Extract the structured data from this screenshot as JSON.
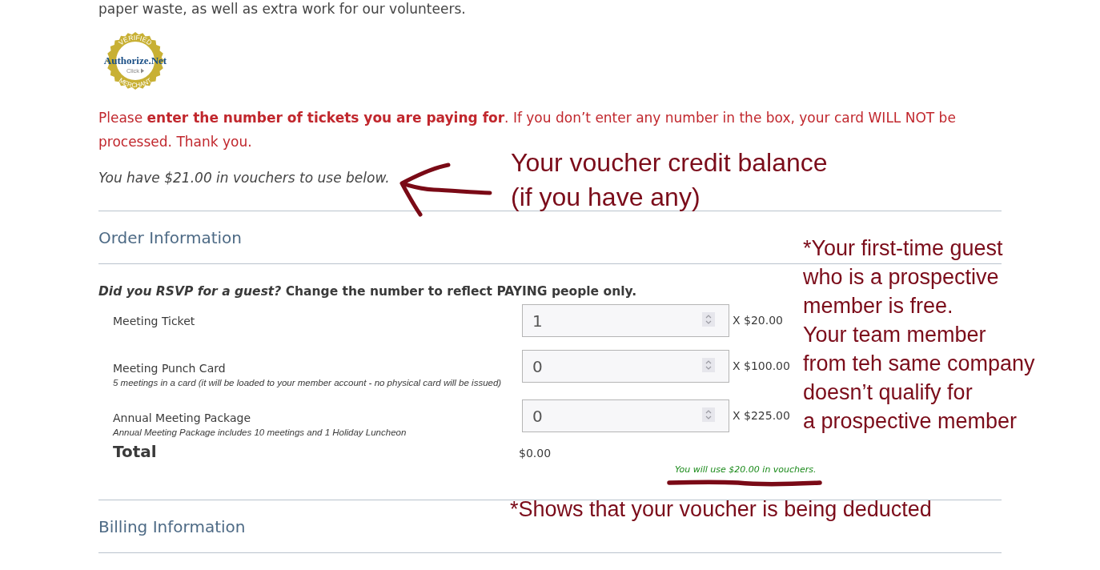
{
  "intro": {
    "text": "paper waste, as well as extra work for our volunteers."
  },
  "seal": {
    "top_text": "VERIFIED",
    "brand": "Authorize.Net",
    "link_text": "Click",
    "bottom_text": "MERCHANT"
  },
  "notice": "Please **enter the number of tickets you are paying for**. If you don’t enter any number in the box, your card WILL NOT be processed. Thank you.",
  "voucher_balance": "You have $21.00 in vouchers to use below.",
  "order": {
    "heading": "Order Information",
    "instruction": "*Did you RSVP for a guest?* Change the number to reflect PAYING people only.",
    "items": [
      {
        "name": "Meeting Ticket",
        "quantity": "1",
        "price": "X $20.00"
      },
      {
        "name": "Meeting Punch Card",
        "note": "5 meetings in a card (it will be loaded to your member account - no physical card will be issued)",
        "quantity": "0",
        "price": "X $100.00"
      },
      {
        "name": "Annual Meeting Package",
        "note": "Annual Meeting Package includes 10 meetings and 1 Holiday Luncheon",
        "quantity": "0",
        "price": "X $225.00"
      }
    ],
    "total_label": "Total",
    "total": "$0.00",
    "voucher_use": "You will use $20.00 in vouchers."
  },
  "billing": {
    "heading": "Billing Information"
  },
  "annotations": [
    {
      "kind": "arrow_note",
      "lines": [
        "Your voucher credit balance",
        "(if you have any)"
      ]
    },
    {
      "kind": "note",
      "lines": [
        "*Your first-time guest",
        "who is a prospective",
        "member is free.",
        "Your team member",
        "from teh same company",
        "doesn’t qualify for",
        "a prospective member"
      ]
    },
    {
      "kind": "underline_note",
      "lines": [
        "*Shows that your voucher is being deducted"
      ]
    }
  ]
}
